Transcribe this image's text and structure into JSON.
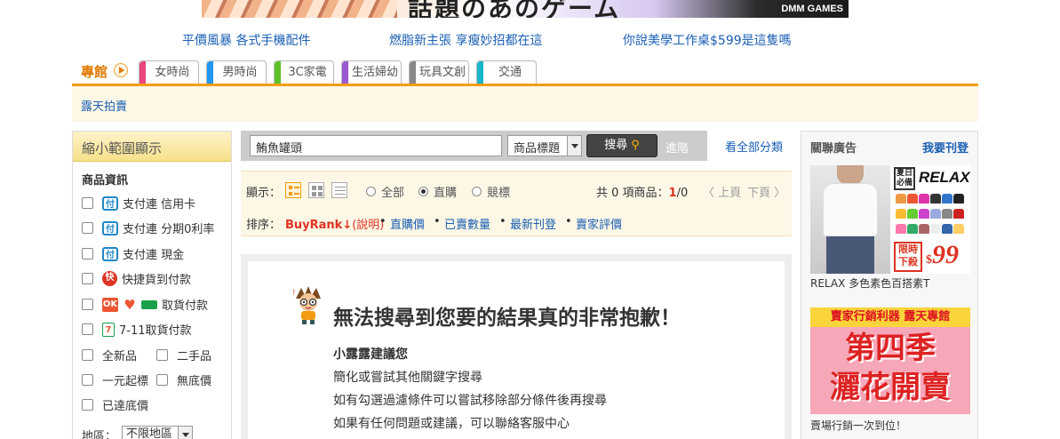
{
  "banner": {
    "text": "話題のあのゲーム",
    "brand": "DMM GAMES"
  },
  "promo_links": [
    "平價風暴 各式手機配件",
    "燃脂新主張 享瘦妙招都在這",
    "你說美學工作桌$599是這隻嗎"
  ],
  "nav": {
    "label": "專館",
    "tabs": [
      {
        "label": "女時尚",
        "color": "#e8467c"
      },
      {
        "label": "男時尚",
        "color": "#2196f3"
      },
      {
        "label": "3C家電",
        "color": "#5cc12a"
      },
      {
        "label": "生活婦幼",
        "color": "#9b59d0"
      },
      {
        "label": "玩具文創",
        "color": "#888888"
      },
      {
        "label": "交通",
        "color": "#19b5c8"
      }
    ],
    "sub_link": "露天拍賣"
  },
  "sidebar": {
    "title": "縮小範圍顯示",
    "section": "商品資訊",
    "options": {
      "credit": "支付連 信用卡",
      "installment": "支付連 分期0利率",
      "cash": "支付連 現金",
      "fast_cod": "快捷貨到付款",
      "store_pickup": "取貨付款",
      "seven": "7-11取貨付款",
      "new": "全新品",
      "used": "二手品",
      "one_dollar": "一元起標",
      "no_reserve": "無底價",
      "reached_reserve": "已達底價"
    },
    "icons": {
      "pay": "付",
      "fast": "快",
      "ok": "OK",
      "heart": "♥",
      "seven": "7"
    },
    "region_label": "地區：",
    "region_value": "不限地區"
  },
  "search": {
    "query": "鮪魚罐頭",
    "field": "商品標題",
    "button": "搜尋",
    "button_icon": "search-icon",
    "advanced": "進階",
    "all_categories": "看全部分類"
  },
  "display": {
    "label": "顯示：",
    "filters": [
      "全部",
      "直購",
      "競標"
    ],
    "selected_filter": "直購",
    "count_prefix": "共 0 項商品：",
    "page_current": "1",
    "page_total": "/0",
    "prev": "〈 上頁",
    "next": "下頁 〉"
  },
  "sort": {
    "label": "排序：",
    "current": "BuyRank↓",
    "current_note": "(說明)",
    "options": [
      "直購價",
      "已賣數量",
      "最新刊登",
      "賣家評價"
    ]
  },
  "noresult": {
    "title": "無法搜尋到您要的結果真的非常抱歉！",
    "subtitle": "小露露建議您",
    "lines": [
      "簡化或嘗試其他關鍵字搜尋",
      "如有勾選過濾條件可以嘗試移除部分條件後再搜尋",
      "如果有任何問題或建議，可以聯絡客服中心"
    ]
  },
  "ads": {
    "title": "關聯廣告",
    "buy": "我要刊登",
    "ad1": {
      "tag": "夏日必備",
      "brand": "RELAX",
      "limit": "限時下殺",
      "price": "99",
      "currency": "$",
      "caption": "RELAX 多色素色百搭素T"
    },
    "ad2": {
      "top": "賣家行銷利器 露天專館",
      "line1": "第四季",
      "line2": "灑花開賣",
      "caption": "賣場行銷一次到位！"
    }
  },
  "colors": {
    "accent": "#f39c12",
    "link": "#1a5fb4",
    "red": "#dd3322"
  }
}
